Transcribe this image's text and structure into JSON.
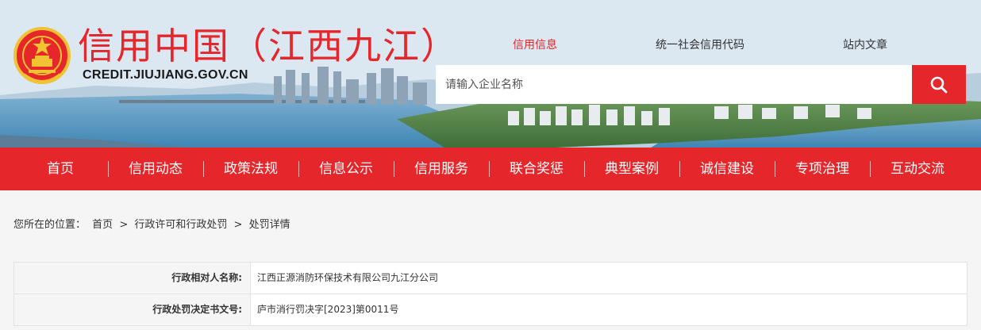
{
  "header": {
    "site_title": "信用中国（江西九江）",
    "site_url": "CREDIT.JIUJIANG.GOV.CN",
    "search_tabs": [
      {
        "label": "信用信息",
        "active": true
      },
      {
        "label": "统一社会信用代码",
        "active": false
      },
      {
        "label": "站内文章",
        "active": false
      }
    ],
    "search_placeholder": "请输入企业名称",
    "search_icon": "search-icon"
  },
  "nav": {
    "items": [
      "首页",
      "信用动态",
      "政策法规",
      "信息公示",
      "信用服务",
      "联合奖惩",
      "典型案例",
      "诚信建设",
      "专项治理",
      "互动交流"
    ]
  },
  "breadcrumb": {
    "prefix": "您所在的位置：",
    "items": [
      "首页",
      "行政许可和行政处罚",
      "处罚详情"
    ],
    "separator": ">"
  },
  "detail": {
    "rows": [
      {
        "label": "行政相对人名称:",
        "value": "江西正源消防环保技术有限公司九江分公司"
      },
      {
        "label": "行政处罚决定书文号:",
        "value": "庐市消行罚决字[2023]第0011号"
      }
    ]
  },
  "colors": {
    "brand_red": "#e5262a"
  }
}
